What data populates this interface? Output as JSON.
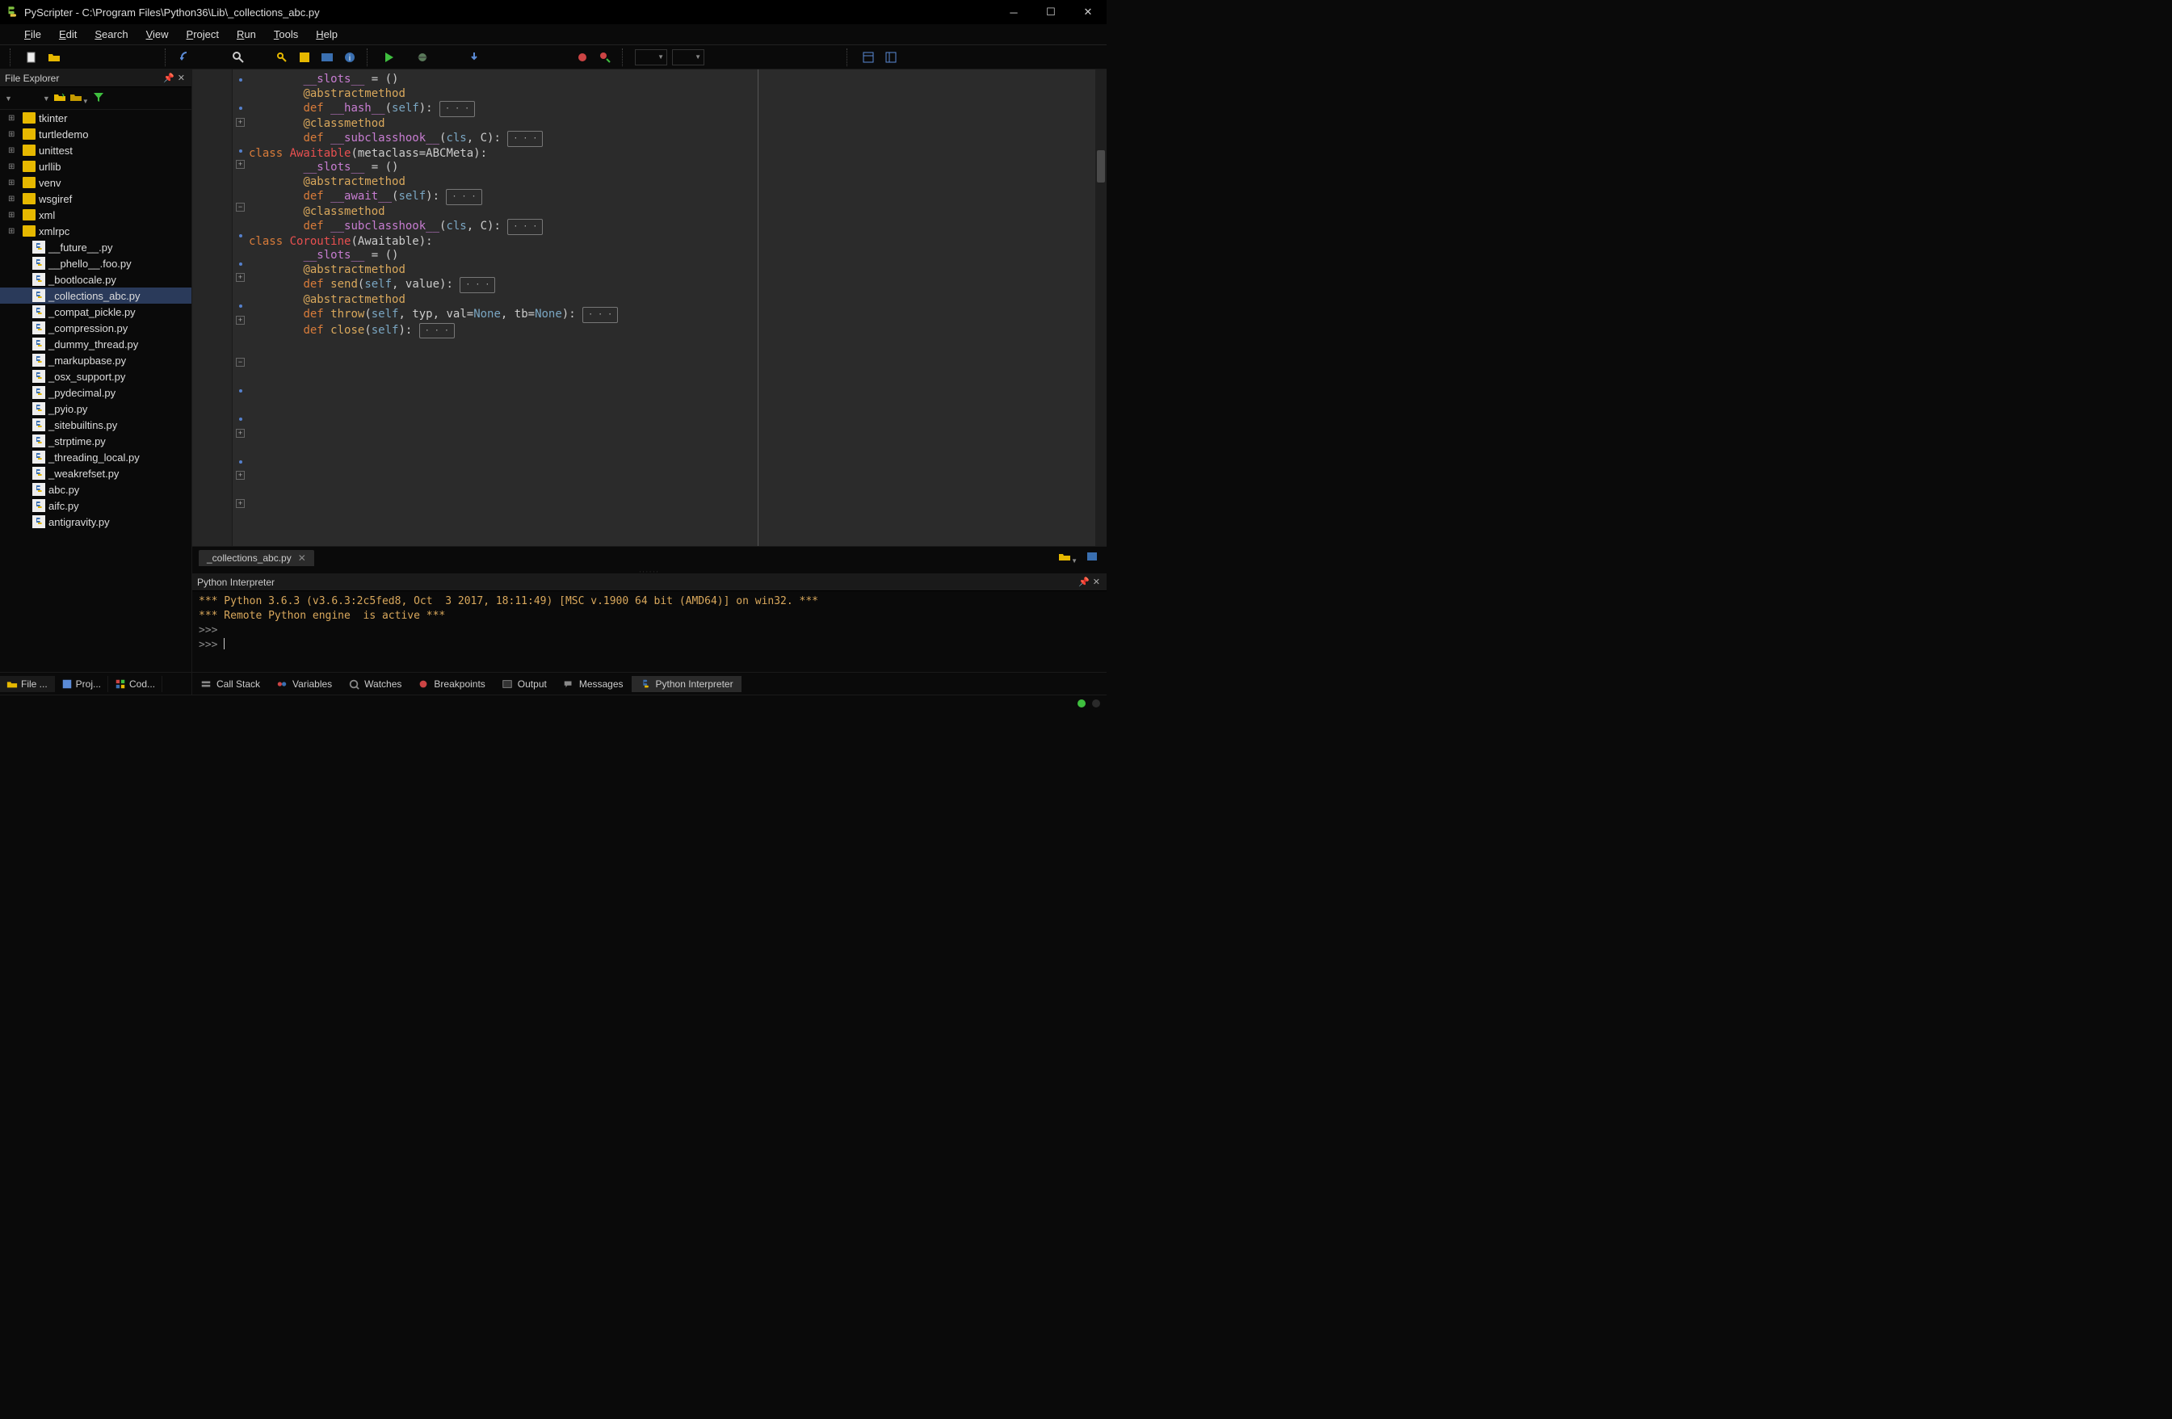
{
  "window": {
    "title": "PyScripter - C:\\Program Files\\Python36\\Lib\\_collections_abc.py"
  },
  "menu": {
    "items": [
      "File",
      "Edit",
      "Search",
      "View",
      "Project",
      "Run",
      "Tools",
      "Help"
    ]
  },
  "sidebar": {
    "title": "File Explorer",
    "folders": [
      "tkinter",
      "turtledemo",
      "unittest",
      "urllib",
      "venv",
      "wsgiref",
      "xml",
      "xmlrpc"
    ],
    "files": [
      "__future__.py",
      "__phello__.foo.py",
      "_bootlocale.py",
      "_collections_abc.py",
      "_compat_pickle.py",
      "_compression.py",
      "_dummy_thread.py",
      "_markupbase.py",
      "_osx_support.py",
      "_pydecimal.py",
      "_pyio.py",
      "_sitebuiltins.py",
      "_strptime.py",
      "_threading_local.py",
      "_weakrefset.py",
      "abc.py",
      "aifc.py",
      "antigravity.py"
    ],
    "selected_file": "_collections_abc.py",
    "tabs": [
      "File ...",
      "Proj...",
      "Cod..."
    ]
  },
  "editor": {
    "tab_name": "_collections_abc.py",
    "code_tokens": [
      {
        "indent": 2,
        "dot": true,
        "parts": [
          {
            "t": "__slots__",
            "c": "dunder"
          },
          {
            "t": " = ()",
            "c": ""
          }
        ]
      },
      {
        "indent": 0,
        "parts": []
      },
      {
        "indent": 2,
        "dot": true,
        "parts": [
          {
            "t": "@abstractmethod",
            "c": "dec"
          }
        ]
      },
      {
        "indent": 2,
        "fold": "+",
        "parts": [
          {
            "t": "def ",
            "c": "kw"
          },
          {
            "t": "__hash__",
            "c": "dunder"
          },
          {
            "t": "(",
            "c": ""
          },
          {
            "t": "self",
            "c": "builtin"
          },
          {
            "t": "): ",
            "c": ""
          },
          {
            "t": "...",
            "c": "fold"
          }
        ]
      },
      {
        "indent": 0,
        "parts": []
      },
      {
        "indent": 2,
        "dot": true,
        "parts": [
          {
            "t": "@classmethod",
            "c": "dec"
          }
        ]
      },
      {
        "indent": 2,
        "fold": "+",
        "parts": [
          {
            "t": "def ",
            "c": "kw"
          },
          {
            "t": "__subclasshook__",
            "c": "dunder"
          },
          {
            "t": "(",
            "c": ""
          },
          {
            "t": "cls",
            "c": "builtin"
          },
          {
            "t": ", C): ",
            "c": ""
          },
          {
            "t": "...",
            "c": "fold"
          }
        ]
      },
      {
        "indent": 0,
        "parts": []
      },
      {
        "indent": 0,
        "parts": []
      },
      {
        "indent": 0,
        "fold": "-",
        "parts": [
          {
            "t": "class ",
            "c": "kw"
          },
          {
            "t": "Awaitable",
            "c": "cls"
          },
          {
            "t": "(metaclass=ABCMeta):",
            "c": ""
          }
        ]
      },
      {
        "indent": 0,
        "parts": []
      },
      {
        "indent": 2,
        "dot": true,
        "parts": [
          {
            "t": "__slots__",
            "c": "dunder"
          },
          {
            "t": " = ()",
            "c": ""
          }
        ]
      },
      {
        "indent": 0,
        "parts": []
      },
      {
        "indent": 2,
        "dot": true,
        "parts": [
          {
            "t": "@abstractmethod",
            "c": "dec"
          }
        ]
      },
      {
        "indent": 2,
        "fold": "+",
        "parts": [
          {
            "t": "def ",
            "c": "kw"
          },
          {
            "t": "__await__",
            "c": "dunder"
          },
          {
            "t": "(",
            "c": ""
          },
          {
            "t": "self",
            "c": "builtin"
          },
          {
            "t": "): ",
            "c": ""
          },
          {
            "t": "...",
            "c": "fold"
          }
        ]
      },
      {
        "indent": 0,
        "parts": []
      },
      {
        "indent": 2,
        "dot": true,
        "parts": [
          {
            "t": "@classmethod",
            "c": "dec"
          }
        ]
      },
      {
        "indent": 2,
        "fold": "+",
        "parts": [
          {
            "t": "def ",
            "c": "kw"
          },
          {
            "t": "__subclasshook__",
            "c": "dunder"
          },
          {
            "t": "(",
            "c": ""
          },
          {
            "t": "cls",
            "c": "builtin"
          },
          {
            "t": ", C): ",
            "c": ""
          },
          {
            "t": "...",
            "c": "fold"
          }
        ]
      },
      {
        "indent": 0,
        "parts": []
      },
      {
        "indent": 0,
        "parts": []
      },
      {
        "indent": 0,
        "fold": "-",
        "parts": [
          {
            "t": "class ",
            "c": "kw"
          },
          {
            "t": "Coroutine",
            "c": "cls"
          },
          {
            "t": "(Awaitable):",
            "c": ""
          }
        ]
      },
      {
        "indent": 0,
        "parts": []
      },
      {
        "indent": 2,
        "dot": true,
        "parts": [
          {
            "t": "__slots__",
            "c": "dunder"
          },
          {
            "t": " = ()",
            "c": ""
          }
        ]
      },
      {
        "indent": 0,
        "parts": []
      },
      {
        "indent": 2,
        "dot": true,
        "parts": [
          {
            "t": "@abstractmethod",
            "c": "dec"
          }
        ]
      },
      {
        "indent": 2,
        "fold": "+",
        "parts": [
          {
            "t": "def ",
            "c": "kw"
          },
          {
            "t": "send",
            "c": "def"
          },
          {
            "t": "(",
            "c": ""
          },
          {
            "t": "self",
            "c": "builtin"
          },
          {
            "t": ", value): ",
            "c": ""
          },
          {
            "t": "...",
            "c": "fold"
          }
        ]
      },
      {
        "indent": 0,
        "parts": []
      },
      {
        "indent": 2,
        "dot": true,
        "parts": [
          {
            "t": "@abstractmethod",
            "c": "dec"
          }
        ]
      },
      {
        "indent": 2,
        "fold": "+",
        "parts": [
          {
            "t": "def ",
            "c": "kw"
          },
          {
            "t": "throw",
            "c": "def"
          },
          {
            "t": "(",
            "c": ""
          },
          {
            "t": "self",
            "c": "builtin"
          },
          {
            "t": ", typ, val=",
            "c": ""
          },
          {
            "t": "None",
            "c": "builtin"
          },
          {
            "t": ", tb=",
            "c": ""
          },
          {
            "t": "None",
            "c": "builtin"
          },
          {
            "t": "): ",
            "c": ""
          },
          {
            "t": "...",
            "c": "fold"
          }
        ]
      },
      {
        "indent": 0,
        "parts": []
      },
      {
        "indent": 2,
        "fold": "+",
        "parts": [
          {
            "t": "def ",
            "c": "kw"
          },
          {
            "t": "close",
            "c": "def"
          },
          {
            "t": "(",
            "c": ""
          },
          {
            "t": "self",
            "c": "builtin"
          },
          {
            "t": "): ",
            "c": ""
          },
          {
            "t": "...",
            "c": "fold"
          }
        ]
      }
    ]
  },
  "interpreter": {
    "title": "Python Interpreter",
    "line1": "*** Python 3.6.3 (v3.6.3:2c5fed8, Oct  3 2017, 18:11:49) [MSC v.1900 64 bit (AMD64)] on win32. ***",
    "line2": "*** Remote Python engine  is active ***",
    "prompt": ">>>"
  },
  "bottom_tabs": [
    "Call Stack",
    "Variables",
    "Watches",
    "Breakpoints",
    "Output",
    "Messages",
    "Python Interpreter"
  ],
  "colors": {
    "led_green": "#3fbf3f",
    "led_dark": "#2a2a2a"
  }
}
